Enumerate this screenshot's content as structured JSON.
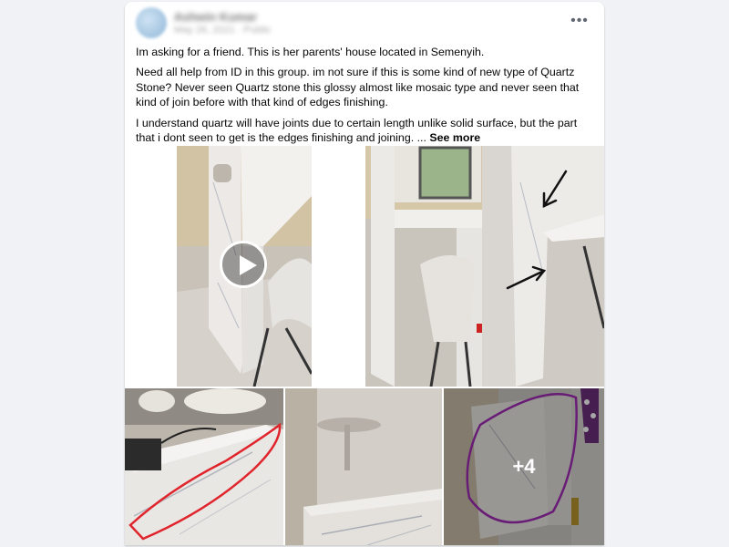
{
  "post": {
    "author": "Ashwin Kumar",
    "timestamp": "May 26, 2021 · Public",
    "paragraphs": [
      "Im asking for a friend. This is her parents' house located in Semenyih.",
      "Need all help from ID in this group. im not sure if this is some kind of new type of Quartz Stone? Never seen Quartz stone this glossy almost like mosaic type and never seen that kind of join before with that kind of edges finishing.",
      "I understand quartz will have joints due to certain length unlike solid surface, but the part that i dont seen to get is the edges finishing and joining. ..."
    ],
    "see_more_label": "See more",
    "more_options_icon": "•••"
  },
  "media": {
    "extra_count": "+4",
    "tiles": [
      {
        "type": "video",
        "icon": "play-icon"
      },
      {
        "type": "image",
        "annotation": "black-arrows"
      },
      {
        "type": "image",
        "annotation": "red-circle"
      },
      {
        "type": "image"
      },
      {
        "type": "image",
        "annotation": "purple-circle"
      }
    ]
  },
  "colors": {
    "background": "#f0f2f5",
    "card": "#ffffff",
    "text": "#050505",
    "secondary_text": "#65676b",
    "annotation_red": "#e0242c",
    "annotation_purple": "#a02bb5"
  }
}
